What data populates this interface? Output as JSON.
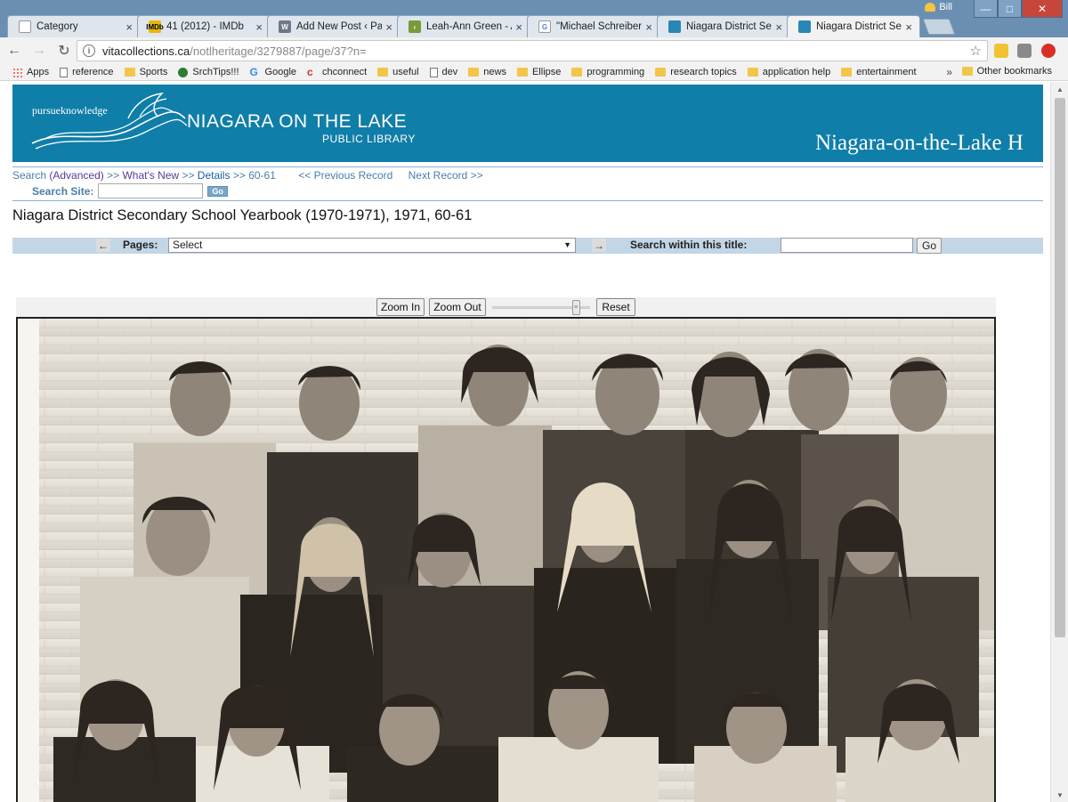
{
  "browser": {
    "tabs": [
      {
        "label": "Category",
        "icon": "document-icon",
        "color": "#ffffff",
        "glyph": ""
      },
      {
        "label": "41 (2012) - IMDb",
        "icon": "imdb-icon",
        "color": "#e8b708",
        "glyph": "IMDb"
      },
      {
        "label": "Add New Post ‹ Palim",
        "icon": "wordpress-icon",
        "color": "#6e7a86",
        "glyph": "W"
      },
      {
        "label": "Leah-Ann Green - An",
        "icon": "leaf-icon",
        "color": "#7a9a3a",
        "glyph": "‹"
      },
      {
        "label": "\"Michael Schreiber\" l",
        "icon": "google-icon",
        "color": "#ffffff",
        "glyph": "G"
      },
      {
        "label": "Niagara District Seco",
        "icon": "vita-icon",
        "color": "#2a87b5",
        "glyph": ""
      },
      {
        "label": "Niagara District Seco",
        "icon": "vita-icon",
        "color": "#2a87b5",
        "glyph": "",
        "active": true
      }
    ],
    "user": "Bill",
    "url_host": "vitacollections.ca",
    "url_path": "/notlheritage/3279887/page/37?n=",
    "bookmarks": [
      {
        "label": "Apps",
        "type": "apps"
      },
      {
        "label": "reference",
        "type": "page"
      },
      {
        "label": "Sports",
        "type": "folder"
      },
      {
        "label": "SrchTips!!!",
        "type": "green"
      },
      {
        "label": "Google",
        "type": "google"
      },
      {
        "label": "chconnect",
        "type": "ch"
      },
      {
        "label": "useful",
        "type": "folder"
      },
      {
        "label": "dev",
        "type": "page"
      },
      {
        "label": "news",
        "type": "folder"
      },
      {
        "label": "Ellipse",
        "type": "folder"
      },
      {
        "label": "programming",
        "type": "folder"
      },
      {
        "label": "research topics",
        "type": "folder"
      },
      {
        "label": "application help",
        "type": "folder"
      },
      {
        "label": "entertainment",
        "type": "folder"
      }
    ],
    "bookmarks_overflow": "»",
    "other_bookmarks": "Other bookmarks"
  },
  "site": {
    "brand_small": "pursueknowledge",
    "library_name": "NIAGARA ON THE LAKE",
    "library_sub": "PUBLIC LIBRARY",
    "banner_title": "Niagara-on-the-Lake H",
    "crumbs": {
      "search": "Search",
      "advanced": "(Advanced)",
      "sep1": ">>",
      "whats_new": "What's New",
      "sep2": ">>",
      "details": "Details",
      "sep3": ">>",
      "pages": "60-61",
      "prev": "<< Previous Record",
      "next": "Next Record >>"
    },
    "search_site_label": "Search Site:",
    "search_site_go": "Go"
  },
  "record": {
    "title": "Niagara District Secondary School Yearbook (1970-1971), 1971, 60-61",
    "pages_label": "Pages:",
    "pages_selected": "Select",
    "search_within_label": "Search within this title:",
    "search_within_go": "Go"
  },
  "viewer": {
    "zoom_in": "Zoom In",
    "zoom_out": "Zoom Out",
    "reset": "Reset",
    "zoom_level": 0.85
  }
}
